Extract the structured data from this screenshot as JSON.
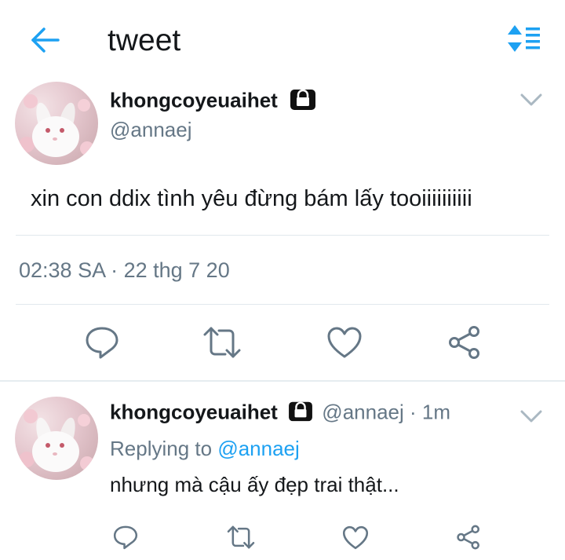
{
  "header": {
    "title": "tweet",
    "back_icon": "arrow-left-icon",
    "sort_icon": "sort-icon",
    "accent_color": "#1da1f2"
  },
  "main_tweet": {
    "display_name": "khongcoyeuaihet",
    "handle": "@annaej",
    "protected_icon": "lock-icon",
    "text": "xin con ddix tình yêu đừng bám lấy tooiiiiiiiiii",
    "timestamp": "02:38 SA · 22 thg 7 20",
    "actions": [
      "reply-icon",
      "retweet-icon",
      "like-icon",
      "share-icon"
    ]
  },
  "reply_tweet": {
    "display_name": "khongcoyeuaihet",
    "handle_time": "@annaej · 1m",
    "replying_prefix": "Replying to ",
    "replying_mention": "@annaej",
    "text": "nhưng mà cậu ấy đẹp trai thật...",
    "actions": [
      "reply-icon",
      "retweet-icon",
      "like-icon",
      "share-icon"
    ]
  }
}
